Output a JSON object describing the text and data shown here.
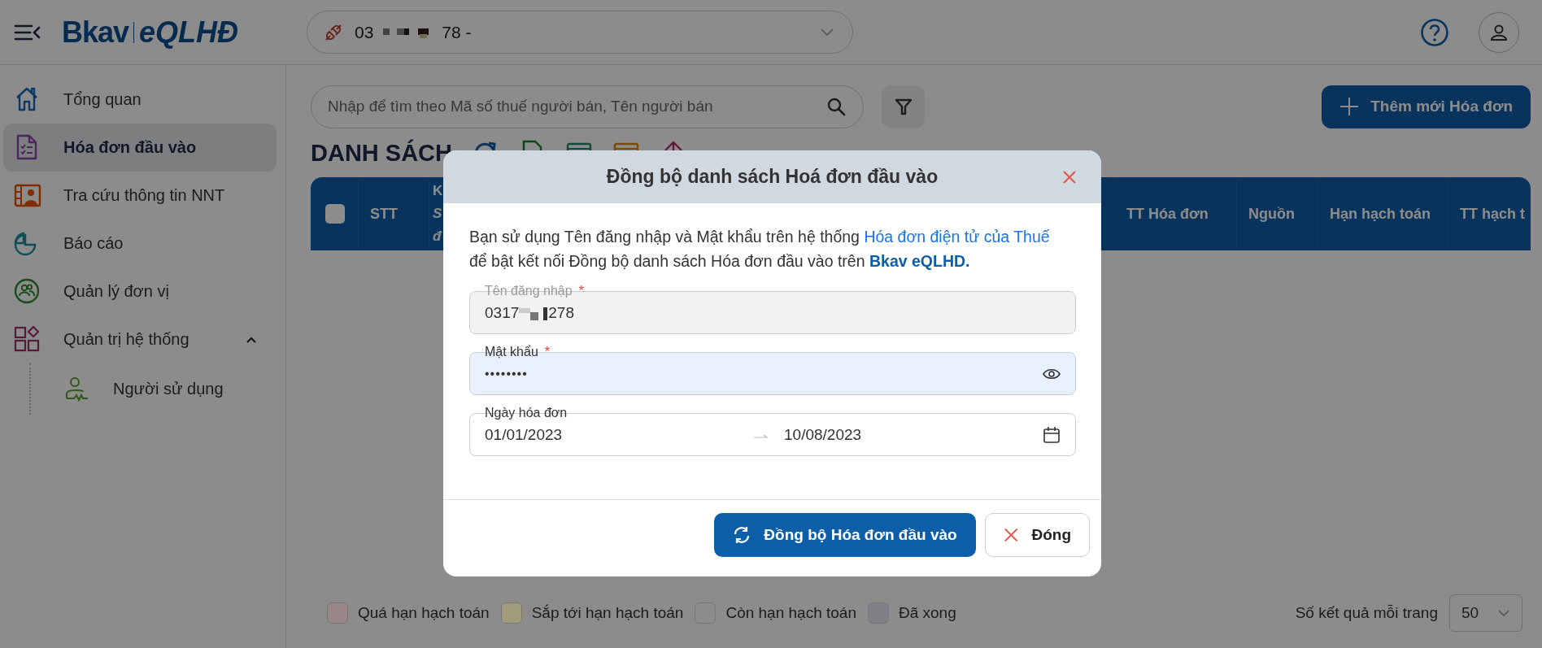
{
  "header": {
    "logo": {
      "brand": "Bkav",
      "product": "eQLHĐ"
    },
    "company_selector": {
      "value_start": "03",
      "value_end": "78 -"
    }
  },
  "sidebar": {
    "items": [
      {
        "label": "Tổng quan",
        "selected": false
      },
      {
        "label": "Hóa đơn đầu vào",
        "selected": true
      },
      {
        "label": "Tra cứu thông tin NNT",
        "selected": false
      },
      {
        "label": "Báo cáo",
        "selected": false
      },
      {
        "label": "Quản lý đơn vị",
        "selected": false
      },
      {
        "label": "Quản trị hệ thống",
        "selected": false,
        "expanded": true,
        "children": [
          {
            "label": "Người sử dụng",
            "selected": false
          }
        ]
      }
    ]
  },
  "search": {
    "placeholder": "Nhập để tìm theo Mã số thuế người bán, Tên người bán"
  },
  "add_button": {
    "label": "Thêm mới Hóa đơn"
  },
  "list_title": "DANH SÁCH",
  "table": {
    "select_all_checked": false,
    "columns": [
      {
        "kind": "check"
      },
      {
        "kind": "text",
        "lines": [
          "STT"
        ]
      },
      {
        "kind": "stack",
        "lines": [
          "K",
          "S",
          "đ"
        ]
      },
      {
        "kind": "text",
        "lines": [
          "TT Hóa đơn"
        ]
      },
      {
        "kind": "text",
        "lines": [
          "Nguồn"
        ]
      },
      {
        "kind": "text",
        "lines": [
          "Hạn hạch toán"
        ]
      },
      {
        "kind": "text",
        "lines": [
          "TT hạch t"
        ]
      }
    ]
  },
  "legend": [
    {
      "label": "Quá hạn hạch toán",
      "color": "#9b8787"
    },
    {
      "label": "Sắp tới hạn hạch toán",
      "color": "#a09b7b"
    },
    {
      "label": "Còn hạn hạch toán",
      "color": "#8d8d8d"
    },
    {
      "label": "Đã xong",
      "color": "#7f8186"
    }
  ],
  "page_size": {
    "label": "Số kết quả mỗi trang",
    "value": "50"
  },
  "dialog": {
    "title": "Đồng bộ danh sách Hoá đơn đầu vào",
    "intro": {
      "text_before": "Bạn sử dụng Tên đăng nhập và Mật khẩu trên hệ thống ",
      "link": "Hóa đơn điện tử của Thuế",
      "text_after": " để bật kết nối Đồng bộ danh sách Hóa đơn đầu vào trên ",
      "brand": "Bkav eQLHD."
    },
    "username": {
      "label": "Tên đăng nhập",
      "required_mark": "*",
      "value_start": "0317",
      "value_end": "278",
      "disabled": true
    },
    "password": {
      "label": "Mật khẩu",
      "required_mark": "*",
      "masked_value": "••••••••"
    },
    "date_range": {
      "label": "Ngày hóa đơn",
      "from": "01/01/2023",
      "to": "10/08/2023"
    },
    "buttons": [
      {
        "label": "Đồng bộ Hóa đơn đầu vào",
        "kind": "primary"
      },
      {
        "label": "Đóng",
        "kind": "close"
      }
    ]
  }
}
